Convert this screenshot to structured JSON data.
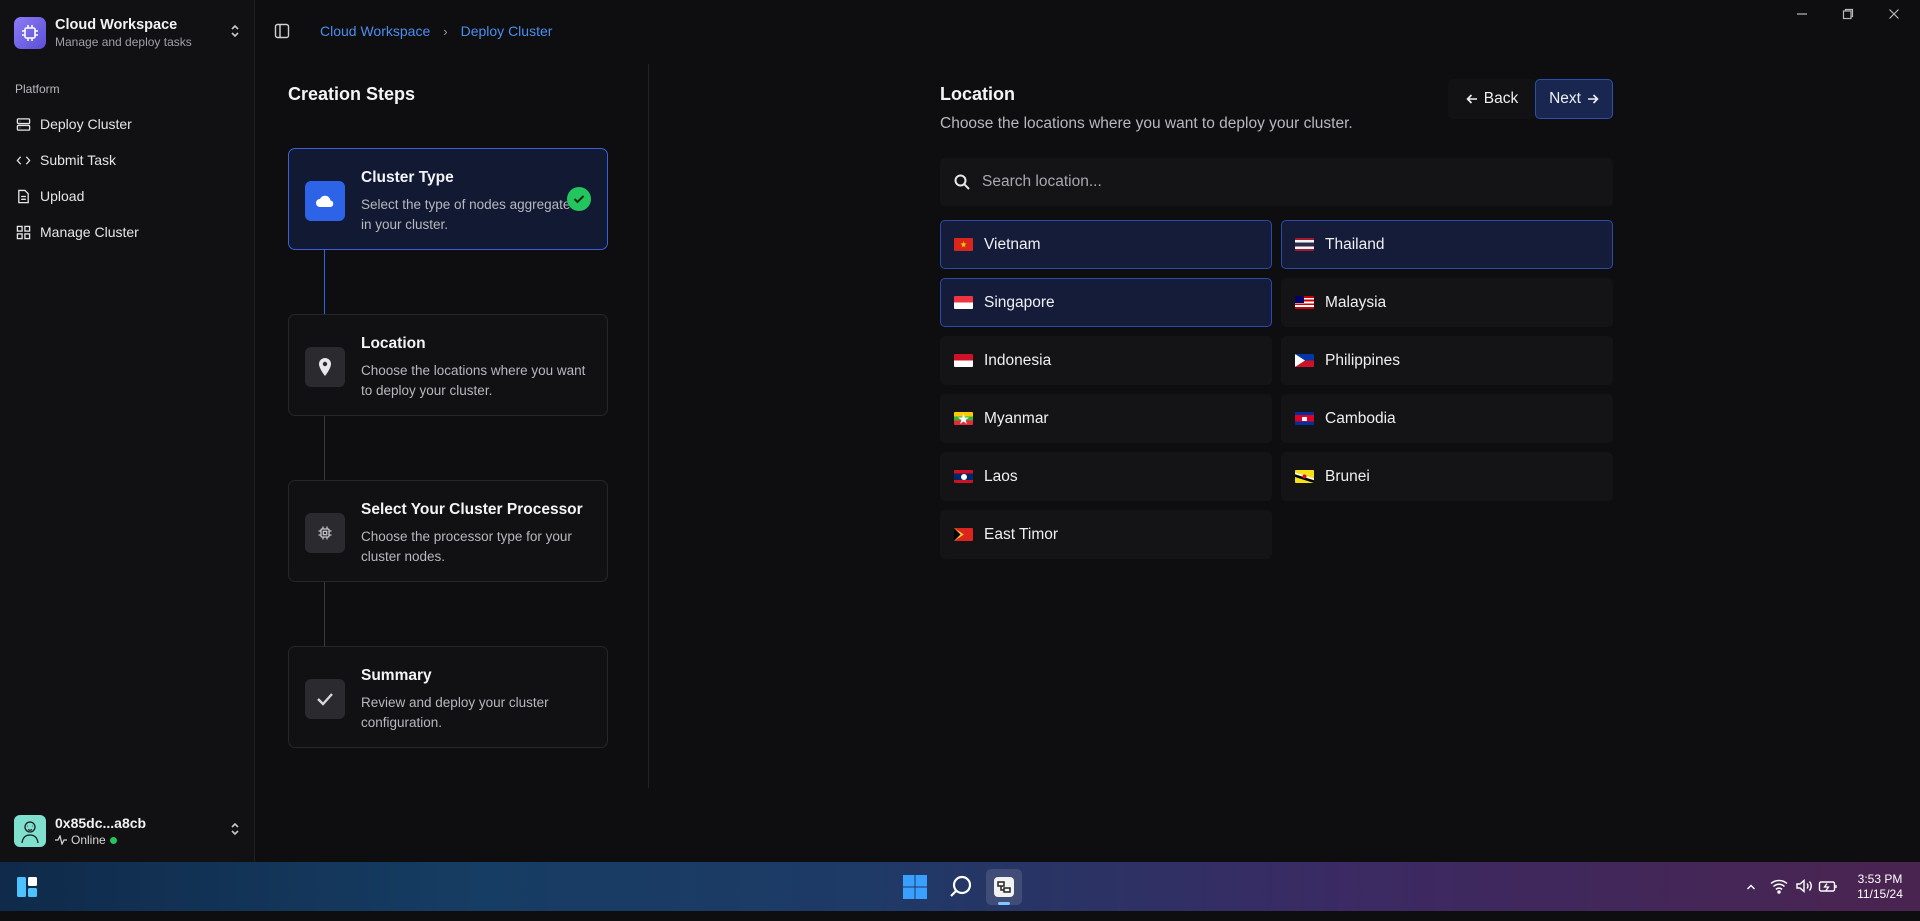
{
  "workspace": {
    "title": "Cloud Workspace",
    "subtitle": "Manage and deploy tasks"
  },
  "sidebar": {
    "section": "Platform",
    "items": [
      {
        "label": "Deploy Cluster",
        "icon": "server-icon"
      },
      {
        "label": "Submit Task",
        "icon": "code-icon"
      },
      {
        "label": "Upload",
        "icon": "file-icon"
      },
      {
        "label": "Manage Cluster",
        "icon": "grid-icon"
      }
    ]
  },
  "user": {
    "name": "0x85dc...a8cb",
    "status": "Online"
  },
  "breadcrumb": [
    "Cloud Workspace",
    "Deploy Cluster"
  ],
  "steps": {
    "title": "Creation Steps",
    "items": [
      {
        "title": "Cluster Type",
        "desc": "Select the type of nodes aggregated in your cluster.",
        "icon": "cloud-icon",
        "completed": true
      },
      {
        "title": "Location",
        "desc": "Choose the locations where you want to deploy your cluster.",
        "icon": "map-pin-icon",
        "completed": false
      },
      {
        "title": "Select Your Cluster Processor",
        "desc": "Choose the processor type for your cluster nodes.",
        "icon": "cpu-icon",
        "completed": false
      },
      {
        "title": "Summary",
        "desc": "Review and deploy your cluster configuration.",
        "icon": "check-icon",
        "completed": false
      }
    ]
  },
  "location": {
    "title": "Location",
    "subtitle": "Choose the locations where you want to deploy your cluster.",
    "back_label": "Back",
    "next_label": "Next",
    "search_placeholder": "Search location...",
    "countries": [
      {
        "name": "Vietnam",
        "selected": true
      },
      {
        "name": "Thailand",
        "selected": true
      },
      {
        "name": "Singapore",
        "selected": true
      },
      {
        "name": "Malaysia",
        "selected": false
      },
      {
        "name": "Indonesia",
        "selected": false
      },
      {
        "name": "Philippines",
        "selected": false
      },
      {
        "name": "Myanmar",
        "selected": false
      },
      {
        "name": "Cambodia",
        "selected": false
      },
      {
        "name": "Laos",
        "selected": false
      },
      {
        "name": "Brunei",
        "selected": false
      },
      {
        "name": "East Timor",
        "selected": false
      }
    ]
  },
  "taskbar": {
    "time": "3:53 PM",
    "date": "11/15/24"
  },
  "colors": {
    "accent": "#2d63e6",
    "success": "#22c55e",
    "link": "#4a8ef0"
  }
}
